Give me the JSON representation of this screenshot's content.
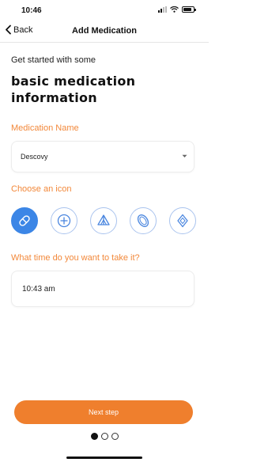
{
  "status_bar": {
    "time": "10:46",
    "icons": [
      "signal-icon",
      "wifi-icon",
      "battery-icon"
    ]
  },
  "nav": {
    "back_label": "Back",
    "title": "Add Medication"
  },
  "intro": {
    "subtitle": "Get started with some",
    "headline_line1": "basic medication",
    "headline_line2": "information"
  },
  "medication_name": {
    "label": "Medication Name",
    "value": "Descovy"
  },
  "icon_picker": {
    "label": "Choose an icon",
    "icons": [
      "capsule-icon",
      "cross-pill-icon",
      "split-tablet-icon",
      "oval-tablet-icon",
      "diamond-pill-icon"
    ],
    "selected_index": 0
  },
  "time_picker": {
    "label": "What time do you want to take it?",
    "value": "10:43 am"
  },
  "footer": {
    "next_label": "Next step",
    "page_count": 3,
    "current_page": 1
  },
  "colors": {
    "accent": "#ef7f2d",
    "label": "#f2883a",
    "selected_icon": "#3c86e6",
    "icon_outline": "#a9c3ee"
  }
}
